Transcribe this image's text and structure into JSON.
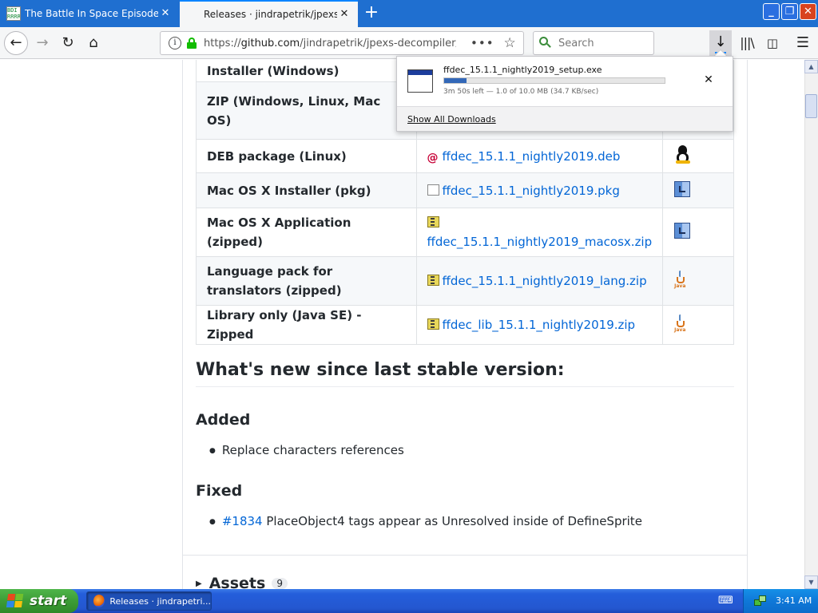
{
  "browser": {
    "tabs": [
      {
        "title": "The Battle In Space Episodes | Ot",
        "active": false
      },
      {
        "title": "Releases · jindrapetrik/jpexs-deco",
        "active": true
      }
    ],
    "url": {
      "prefix": "https://",
      "host": "github.com",
      "path": "/jindrapetrik/jpexs-decompiler/relea"
    },
    "search_placeholder": "Search",
    "icons": {
      "back": "back-arrow-icon",
      "forward": "forward-arrow-icon",
      "reload": "reload-icon",
      "home": "home-icon",
      "downloads": "download-arrow-icon",
      "library": "library-icon",
      "sidebar": "sidebar-icon",
      "menu": "hamburger-menu-icon"
    }
  },
  "downloads_panel": {
    "filename": "ffdec_15.1.1_nightly2019_setup.exe",
    "status": "3m 50s left — 1.0 of 10.0 MB (34.7 KB/sec)",
    "progress": 0.1,
    "show_all": "Show All Downloads"
  },
  "downloads_table": {
    "rows": [
      {
        "name": "Installer (Windows)",
        "file": "",
        "os_icon": ""
      },
      {
        "name": "ZIP (Windows, Linux, Mac OS)",
        "file": "",
        "os_icon": ""
      },
      {
        "name": "DEB package (Linux)",
        "file": "ffdec_15.1.1_nightly2019.deb",
        "file_icon": "debian-icon",
        "os_icon": "linux-tux-icon"
      },
      {
        "name": "Mac OS X Installer (pkg)",
        "file": "ffdec_15.1.1_nightly2019.pkg",
        "file_icon": "pkg-icon",
        "os_icon": "mac-finder-icon"
      },
      {
        "name": "Mac OS X Application (zipped)",
        "file": "ffdec_15.1.1_nightly2019_macosx.zip",
        "file_icon": "zip-icon",
        "os_icon": "mac-finder-icon"
      },
      {
        "name": "Language pack for translators (zipped)",
        "file": "ffdec_15.1.1_nightly2019_lang.zip",
        "file_icon": "zip-icon",
        "os_icon": "java-icon"
      },
      {
        "name": "Library only (Java SE) - Zipped",
        "file": "ffdec_lib_15.1.1_nightly2019.zip",
        "file_icon": "zip-icon",
        "os_icon": "java-icon"
      }
    ]
  },
  "release_notes": {
    "heading": "What's new since last stable version:",
    "added": {
      "heading": "Added",
      "items": [
        "Replace characters references"
      ]
    },
    "fixed": {
      "heading": "Fixed",
      "items": [
        {
          "issue": "#1834",
          "text": " PlaceObject4 tags appear as Unresolved inside of DefineSprite"
        }
      ]
    },
    "assets": {
      "label": "Assets",
      "count": "9"
    }
  },
  "taskbar": {
    "start_label": "start",
    "task_label": "Releases · jindrapetri...",
    "clock": "3:41 AM"
  },
  "colors": {
    "link": "#0366d6",
    "tabbar": "#1f6fd0",
    "progress": "#3368b8",
    "taskbar": "#245edb",
    "start_button": "#3c9c36"
  }
}
